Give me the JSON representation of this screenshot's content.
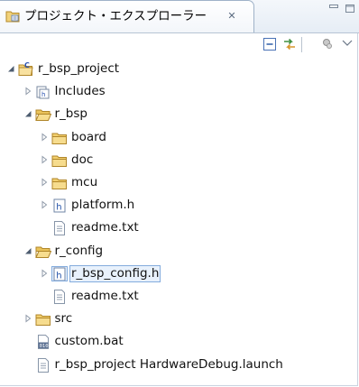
{
  "view": {
    "title": "プロジェクト・エクスプローラー",
    "close_glyph": "✕"
  },
  "tree": [
    {
      "id": "r_bsp_project",
      "label": "r_bsp_project",
      "icon": "c-project-icon",
      "level": 0,
      "twisty": "expanded"
    },
    {
      "id": "includes",
      "label": "Includes",
      "icon": "includes-icon",
      "level": 1,
      "twisty": "collapsed"
    },
    {
      "id": "r_bsp",
      "label": "r_bsp",
      "icon": "folder-open-icon",
      "level": 1,
      "twisty": "expanded"
    },
    {
      "id": "board",
      "label": "board",
      "icon": "folder-icon",
      "level": 2,
      "twisty": "collapsed"
    },
    {
      "id": "doc",
      "label": "doc",
      "icon": "folder-icon",
      "level": 2,
      "twisty": "collapsed"
    },
    {
      "id": "mcu",
      "label": "mcu",
      "icon": "folder-icon",
      "level": 2,
      "twisty": "collapsed"
    },
    {
      "id": "platform_h",
      "label": "platform.h",
      "icon": "header-file-icon",
      "level": 2,
      "twisty": "collapsed"
    },
    {
      "id": "readme_txt_1",
      "label": "readme.txt",
      "icon": "text-file-icon",
      "level": 2,
      "twisty": "none"
    },
    {
      "id": "r_config",
      "label": "r_config",
      "icon": "folder-open-icon",
      "level": 1,
      "twisty": "expanded"
    },
    {
      "id": "r_bsp_config_h",
      "label": "r_bsp_config.h",
      "icon": "header-file-icon",
      "level": 2,
      "twisty": "collapsed",
      "selected": true
    },
    {
      "id": "readme_txt_2",
      "label": "readme.txt",
      "icon": "text-file-icon",
      "level": 2,
      "twisty": "none"
    },
    {
      "id": "src",
      "label": "src",
      "icon": "folder-icon",
      "level": 1,
      "twisty": "collapsed"
    },
    {
      "id": "custom_bat",
      "label": "custom.bat",
      "icon": "binary-file-icon",
      "level": 1,
      "twisty": "none"
    },
    {
      "id": "launch",
      "label": "r_bsp_project HardwareDebug.launch",
      "icon": "text-file-icon",
      "level": 1,
      "twisty": "none"
    }
  ]
}
